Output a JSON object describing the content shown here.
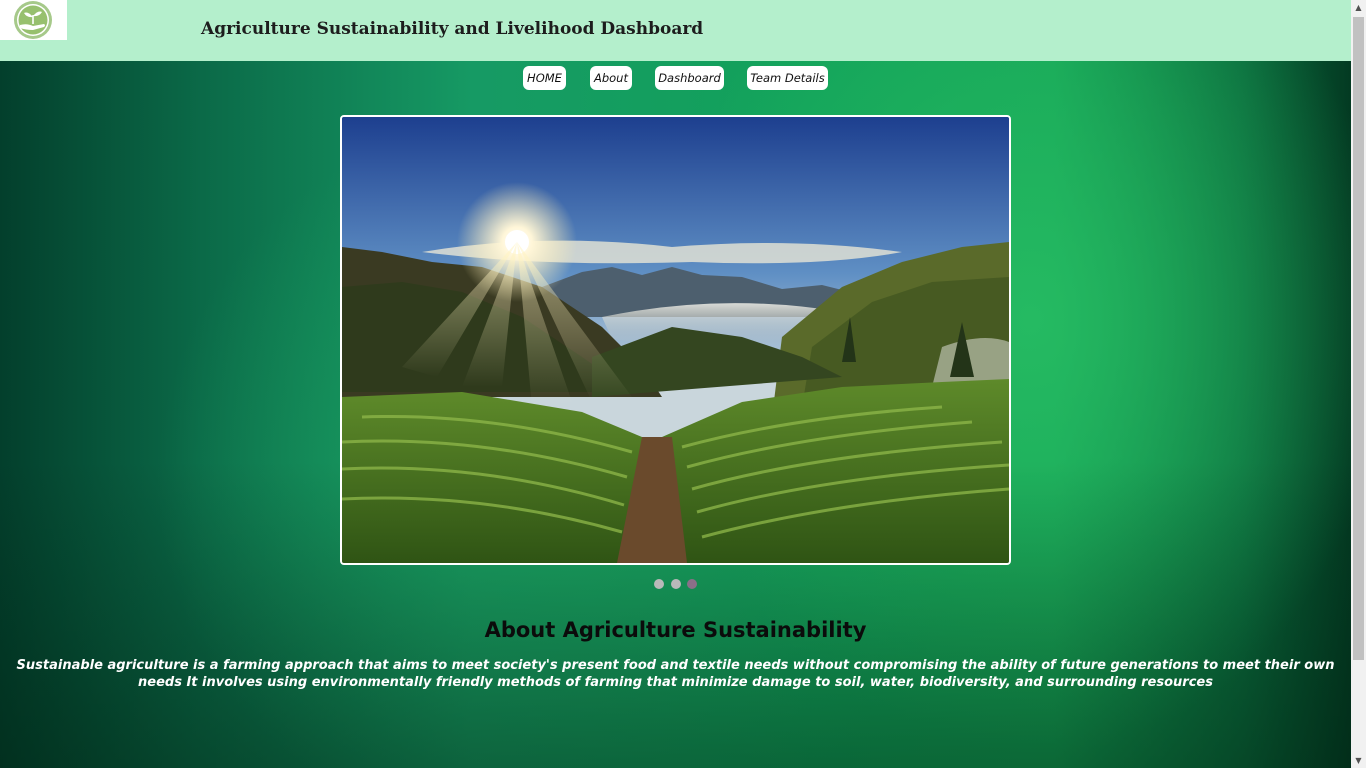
{
  "header": {
    "title": "Agriculture Sustainability and Livelihood Dashboard",
    "logo_icon": "hand-holding-sprout-icon",
    "background": "#b4efcc"
  },
  "nav": {
    "items": [
      {
        "label": "HOME"
      },
      {
        "label": "About"
      },
      {
        "label": "Dashboard"
      },
      {
        "label": "Team Details"
      }
    ]
  },
  "carousel": {
    "slide_count": 3,
    "active_index": 2
  },
  "about": {
    "title": "About Agriculture Sustainability",
    "text": "Sustainable agriculture is a farming approach that aims to meet society's present food and textile needs without compromising the ability of future generations to meet their own needs It involves using environmentally friendly methods of farming that minimize damage to soil, water, biodiversity, and surrounding resources"
  },
  "colors": {
    "accent_green": "#12a25a",
    "dark_green": "#033f2c",
    "header_mint": "#b4efcc"
  }
}
